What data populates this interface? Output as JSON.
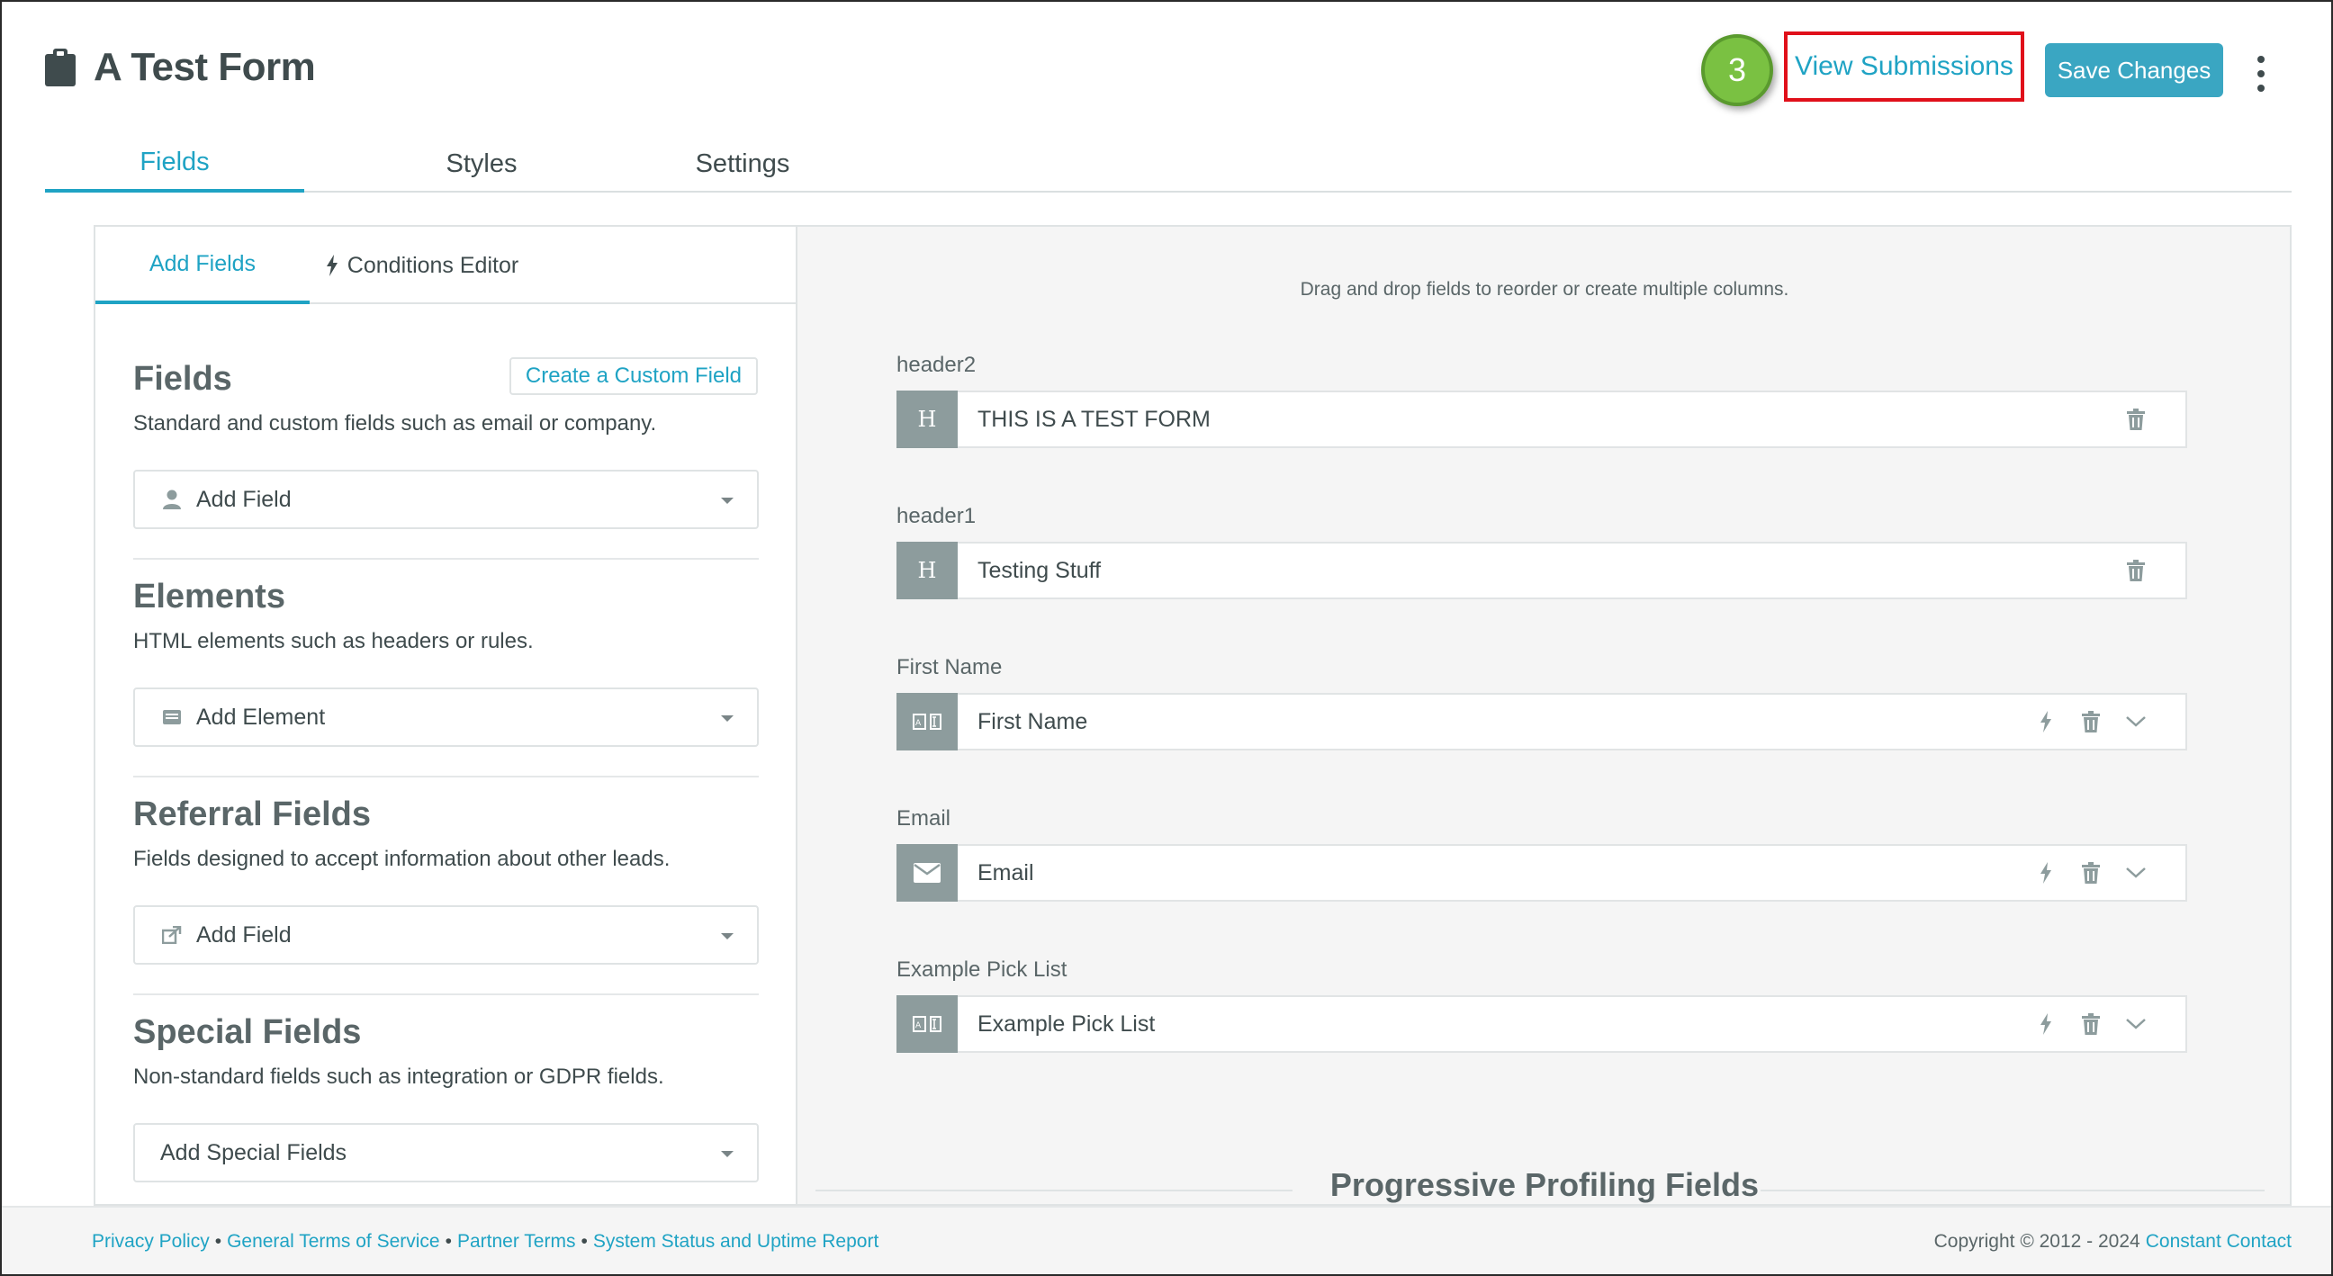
{
  "header": {
    "title": "A Test Form",
    "step_number": "3",
    "view_submissions_label": "View Submissions",
    "save_label": "Save Changes"
  },
  "main_tabs": [
    {
      "label": "Fields",
      "active": true
    },
    {
      "label": "Styles",
      "active": false
    },
    {
      "label": "Settings",
      "active": false
    }
  ],
  "left_panel": {
    "sub_tabs": [
      {
        "label": "Add Fields",
        "active": true
      },
      {
        "label": "Conditions Editor",
        "active": false
      }
    ],
    "create_custom_label": "Create a Custom Field",
    "sections": [
      {
        "title": "Fields",
        "description": "Standard and custom fields such as email or company.",
        "dropdown": "Add Field",
        "icon": "person-icon"
      },
      {
        "title": "Elements",
        "description": "HTML elements such as headers or rules.",
        "dropdown": "Add Element",
        "icon": "element-icon"
      },
      {
        "title": "Referral Fields",
        "description": "Fields designed to accept information about other leads.",
        "dropdown": "Add Field",
        "icon": "share-icon"
      },
      {
        "title": "Special Fields",
        "description": "Non-standard fields such as integration or GDPR fields.",
        "dropdown": "Add Special Fields",
        "icon": ""
      }
    ]
  },
  "right_panel": {
    "hint": "Drag and drop fields to reorder or create multiple columns.",
    "fields": [
      {
        "label": "header2",
        "value": "THIS IS A TEST FORM",
        "type": "H",
        "type_icon": "header-icon"
      },
      {
        "label": "header1",
        "value": "Testing Stuff",
        "type": "H",
        "type_icon": "header-icon"
      },
      {
        "label": "First Name",
        "value": "First Name",
        "type": "",
        "type_icon": "text-field-icon"
      },
      {
        "label": "Email",
        "value": "Email",
        "type": "",
        "type_icon": "envelope-icon"
      },
      {
        "label": "Example Pick List",
        "value": "Example Pick List",
        "type": "",
        "type_icon": "text-field-icon"
      }
    ],
    "progressive_title": "Progressive Profiling Fields"
  },
  "footer": {
    "links": [
      "Privacy Policy",
      "General Terms of Service",
      "Partner Terms",
      "System Status and Uptime Report"
    ],
    "copyright": "Copyright © 2012 - 2024",
    "brand": "Constant Contact"
  },
  "colors": {
    "accent": "#1fa3c4",
    "save_button": "#3aa6c2",
    "highlight_box": "#e0101a",
    "step_badge": "#7ac142",
    "badge_gray": "#8d9c9d"
  }
}
